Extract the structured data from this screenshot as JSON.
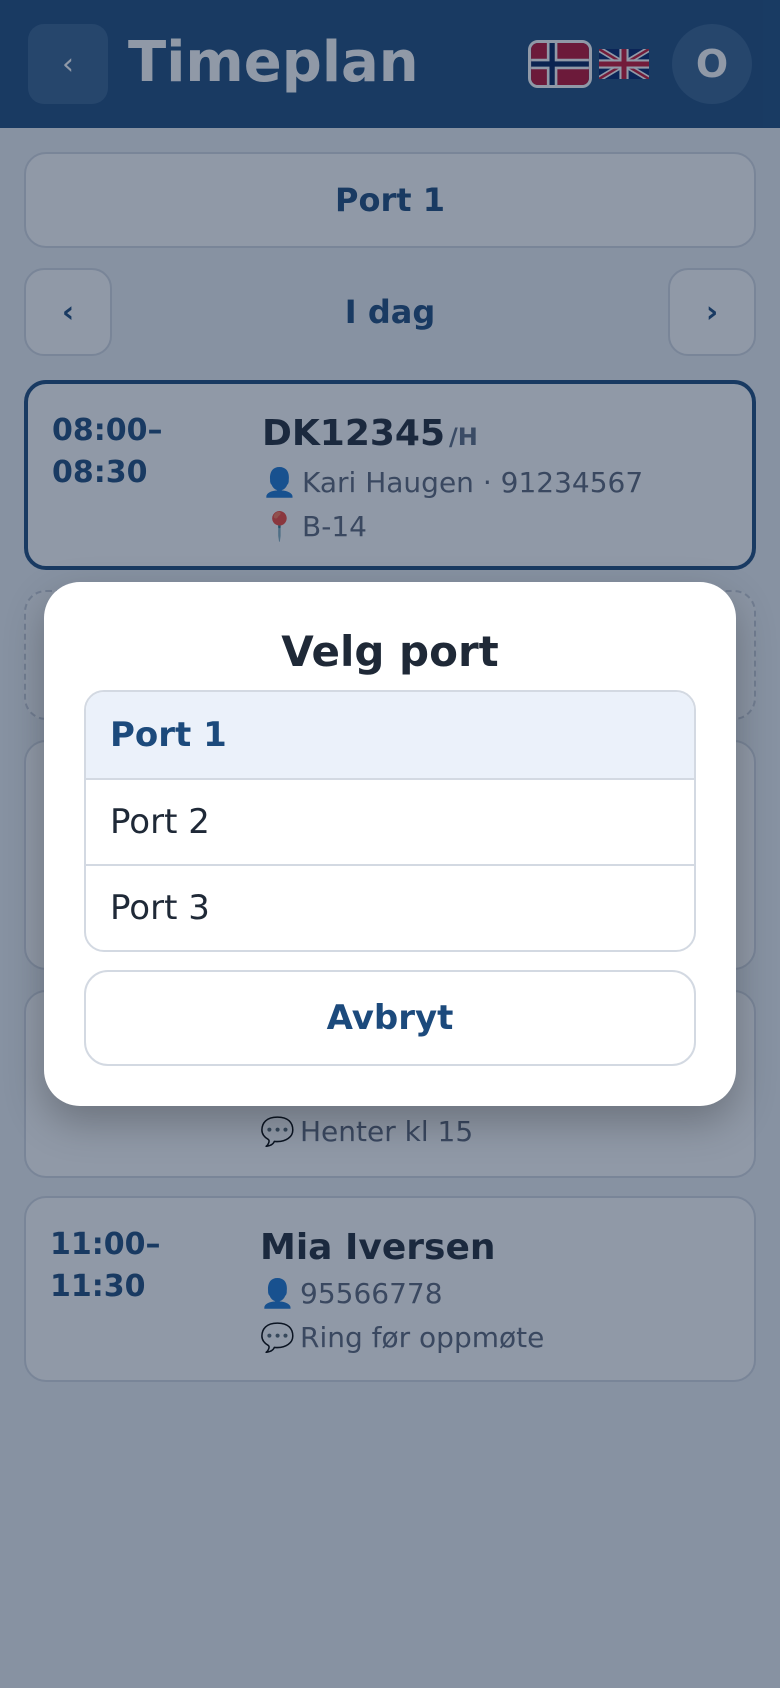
{
  "header": {
    "back_icon": "‹",
    "title": "Timeplan",
    "avatar_initial": "O",
    "lang_no_icon": "norway-flag-icon",
    "lang_en_icon": "uk-flag-icon"
  },
  "port_selector": {
    "label": "Port 1"
  },
  "date_nav": {
    "prev_icon": "‹",
    "label": "I dag",
    "next_icon": "›"
  },
  "bookings": [
    {
      "time_start": "08:00–",
      "time_end": "08:30",
      "title": "DK12345",
      "suffix": "/H",
      "line1_icon": "👤",
      "line1": "Kari Haugen · 91234567",
      "line2_icon": "📍",
      "line2": "B-14"
    },
    {
      "line2_icon": "💬",
      "line2": "Henter kl 15"
    },
    {
      "time_start": "11:00–",
      "time_end": "11:30",
      "title": "Mia Iversen",
      "line1_icon": "👤",
      "line1": "95566778",
      "line2_icon": "💬",
      "line2": "Ring før oppmøte"
    }
  ],
  "modal": {
    "title": "Velg port",
    "options": [
      "Port 1",
      "Port 2",
      "Port 3"
    ],
    "selected": "Port 1",
    "cancel_label": "Avbryt"
  },
  "colors": {
    "primary": "#1c4a7c",
    "header_button": "#34608f",
    "selected_option_bg": "#ebf1fa",
    "border": "#d3d9e2"
  }
}
